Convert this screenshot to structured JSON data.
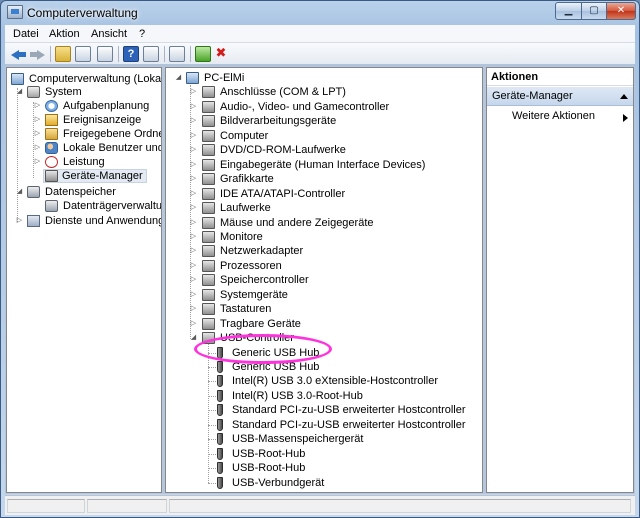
{
  "window": {
    "title": "Computerverwaltung"
  },
  "menu": [
    "Datei",
    "Aktion",
    "Ansicht",
    "?"
  ],
  "toolbar_icons": [
    "back-arrow-icon",
    "forward-arrow-icon",
    "folder-up-icon",
    "console-tree-icon",
    "properties-icon",
    "help-icon",
    "view-icon",
    "scan-hardware-icon",
    "update-driver-icon",
    "uninstall-icon"
  ],
  "left_tree": {
    "root": "Computerverwaltung (Lokal)",
    "items": [
      {
        "label": "System",
        "level": 1,
        "expanded": true
      },
      {
        "label": "Aufgabenplanung",
        "level": 2
      },
      {
        "label": "Ereignisanzeige",
        "level": 2
      },
      {
        "label": "Freigegebene Ordner",
        "level": 2
      },
      {
        "label": "Lokale Benutzer und Gr",
        "level": 2
      },
      {
        "label": "Leistung",
        "level": 2
      },
      {
        "label": "Geräte-Manager",
        "level": 2,
        "selected": true
      },
      {
        "label": "Datenspeicher",
        "level": 1,
        "expanded": true
      },
      {
        "label": "Datenträgerverwaltung",
        "level": 2
      },
      {
        "label": "Dienste und Anwendungen",
        "level": 1
      }
    ]
  },
  "device_tree": {
    "root": "PC-ElMi",
    "categories": [
      "Anschlüsse (COM & LPT)",
      "Audio-, Video- und Gamecontroller",
      "Bildverarbeitungsgeräte",
      "Computer",
      "DVD/CD-ROM-Laufwerke",
      "Eingabegeräte (Human Interface Devices)",
      "Grafikkarte",
      "IDE ATA/ATAPI-Controller",
      "Laufwerke",
      "Mäuse und andere Zeigegeräte",
      "Monitore",
      "Netzwerkadapter",
      "Prozessoren",
      "Speichercontroller",
      "Systemgeräte",
      "Tastaturen",
      "Tragbare Geräte",
      "USB-Controller"
    ],
    "usb_children": [
      "Generic USB Hub",
      "Generic USB Hub",
      "Intel(R) USB 3.0 eXtensible-Hostcontroller",
      "Intel(R) USB 3.0-Root-Hub",
      "Standard PCI-zu-USB erweiterter Hostcontroller",
      "Standard PCI-zu-USB erweiterter Hostcontroller",
      "USB-Massenspeichergerät",
      "USB-Root-Hub",
      "USB-Root-Hub",
      "USB-Verbundgerät"
    ]
  },
  "actions": {
    "header": "Aktionen",
    "section": "Geräte-Manager",
    "item": "Weitere Aktionen"
  },
  "colors": {
    "highlight": "#ff33dd",
    "selection": "#e3eaf3"
  }
}
